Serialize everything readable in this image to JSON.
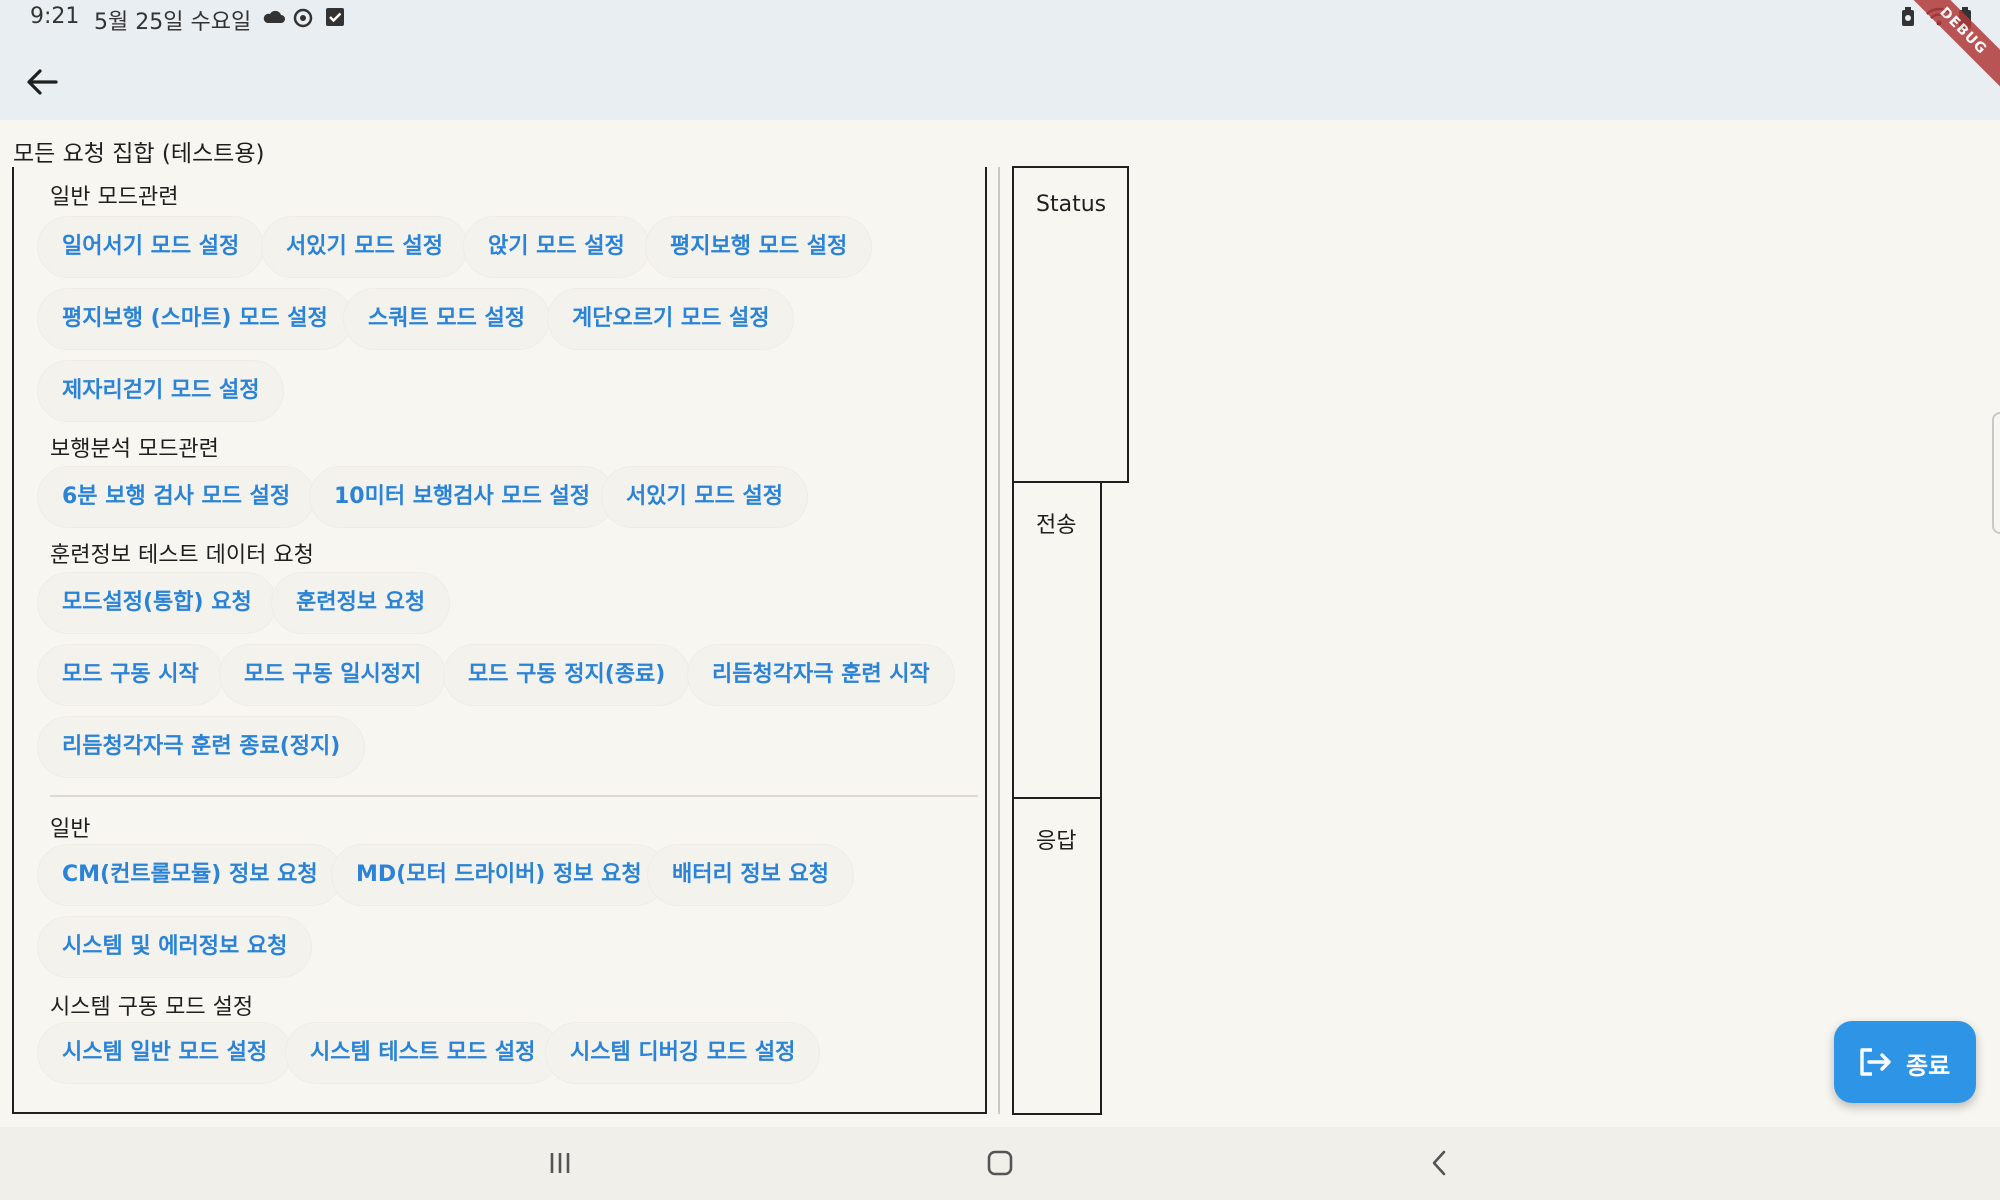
{
  "status_bar": {
    "time": "9:21",
    "date": "5월 25일 수요일",
    "icons": [
      "cloud-icon",
      "sync-icon",
      "checkbox-icon",
      "battery-saver-icon",
      "wifi-icon",
      "battery-icon"
    ]
  },
  "app_bar": {
    "back_icon": "arrow-left-icon",
    "debug_label": "DEBUG"
  },
  "page_title": "모든 요청 집합 (테스트용)",
  "sections": [
    {
      "label": "일반 모드관련",
      "buttons": [
        "일어서기 모드 설정",
        "서있기 모드 설정",
        "앉기 모드 설정",
        "평지보행 모드 설정",
        "평지보행 (스마트) 모드 설정",
        "스쿼트 모드 설정",
        "계단오르기 모드 설정",
        "제자리걷기 모드 설정"
      ]
    },
    {
      "label": "보행분석 모드관련",
      "buttons": [
        "6분 보행 검사 모드 설정",
        "10미터 보행검사 모드 설정",
        "서있기 모드 설정"
      ]
    },
    {
      "label": "훈련정보 테스트 데이터 요청",
      "buttons": [
        "모드설정(통합) 요청",
        "훈련정보 요청",
        "모드 구동 시작",
        "모드 구동 일시정지",
        "모드 구동 정지(종료)",
        "리듬청각자극 훈련 시작",
        "리듬청각자극 훈련 종료(정지)"
      ]
    },
    {
      "label": "일반",
      "buttons": [
        "CM(컨트롤모듈) 정보 요청",
        "MD(모터 드라이버) 정보 요청",
        "배터리 정보 요청",
        "시스템 및 에러정보 요청"
      ]
    },
    {
      "label": "시스템 구동 모드 설정",
      "buttons": [
        "시스템 일반 모드 설정",
        "시스템 테스트 모드 설정",
        "시스템 디버깅 모드 설정"
      ]
    }
  ],
  "panels": {
    "status": "Status",
    "send": "전송",
    "response": "응답"
  },
  "fab": {
    "label": "종료",
    "icon": "logout-icon"
  },
  "nav_bar": {
    "icons": [
      "recents-icon",
      "home-icon",
      "back-nav-icon"
    ]
  },
  "colors": {
    "background": "#F8F6F1",
    "appbar": "#E8EEF1",
    "chip_text": "#2A83D6",
    "fab": "#2E95E6"
  }
}
